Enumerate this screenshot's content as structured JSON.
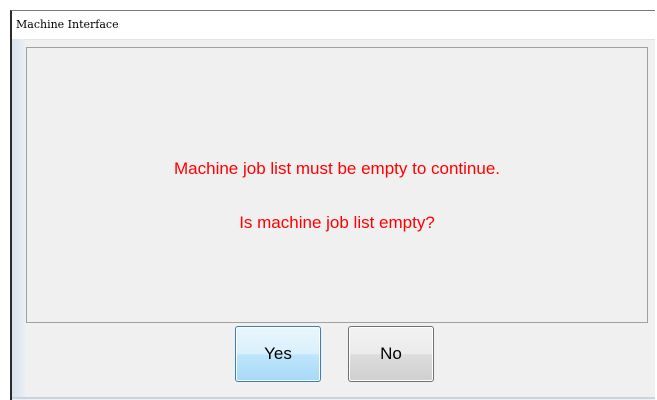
{
  "window": {
    "title": "Machine Interface"
  },
  "message": {
    "line1": "Machine job list must be empty to continue.",
    "line2": "Is machine job list empty?",
    "text_color": "#ff0000"
  },
  "buttons": {
    "yes_label": "Yes",
    "no_label": "No",
    "default_button": "Yes"
  }
}
